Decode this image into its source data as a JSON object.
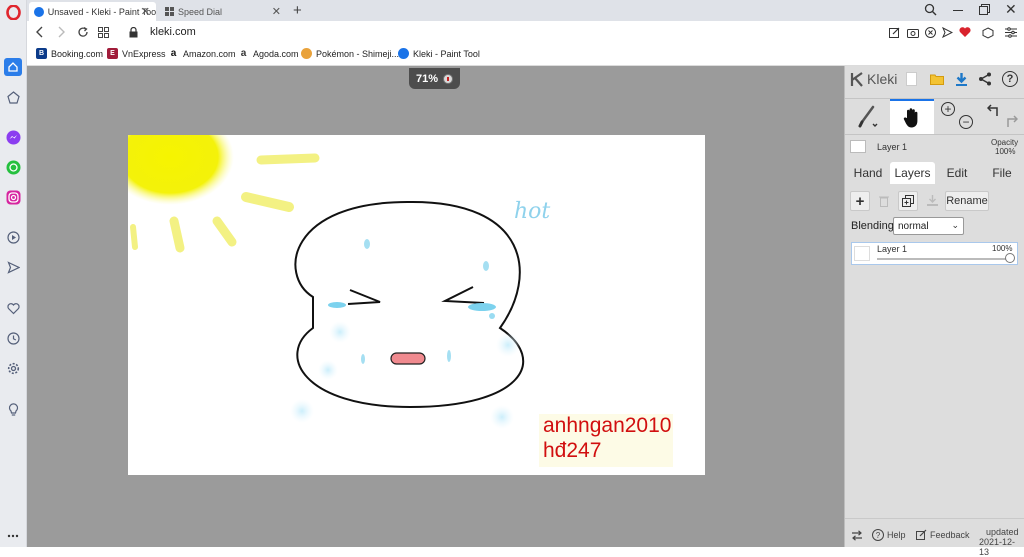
{
  "browser": {
    "tabs": [
      {
        "title": "Unsaved - Kleki - Paint Tool",
        "active": true
      },
      {
        "title": "Speed Dial",
        "active": false
      }
    ],
    "url": "kleki.com",
    "bookmarks": [
      "Booking.com",
      "VnExpress",
      "Amazon.com",
      "Agoda.com",
      "Pokémon - Shimeji...",
      "Kleki - Paint Tool"
    ]
  },
  "canvas": {
    "zoom": "71%",
    "text_hot": "hot",
    "signature_line1": "anhngan2010",
    "signature_line2": "hđ247"
  },
  "panel": {
    "app_name": "Kleki",
    "layer_name": "Layer 1",
    "opacity_label": "Opacity",
    "opacity_value": "100%",
    "tabs": [
      "Hand",
      "Layers",
      "Edit",
      "File"
    ],
    "active_tab": "Layers",
    "rename_label": "Rename",
    "blending_label": "Blending",
    "blending_value": "normal",
    "layer_item_name": "Layer 1",
    "layer_item_opacity": "100%",
    "help_label": "Help",
    "feedback_label": "Feedback",
    "updated_label": "updated",
    "updated_date": "2021-12-13"
  },
  "colors": {
    "accent": "#1a73e8",
    "signature": "#d10f0f",
    "download": "#1e78c8"
  }
}
